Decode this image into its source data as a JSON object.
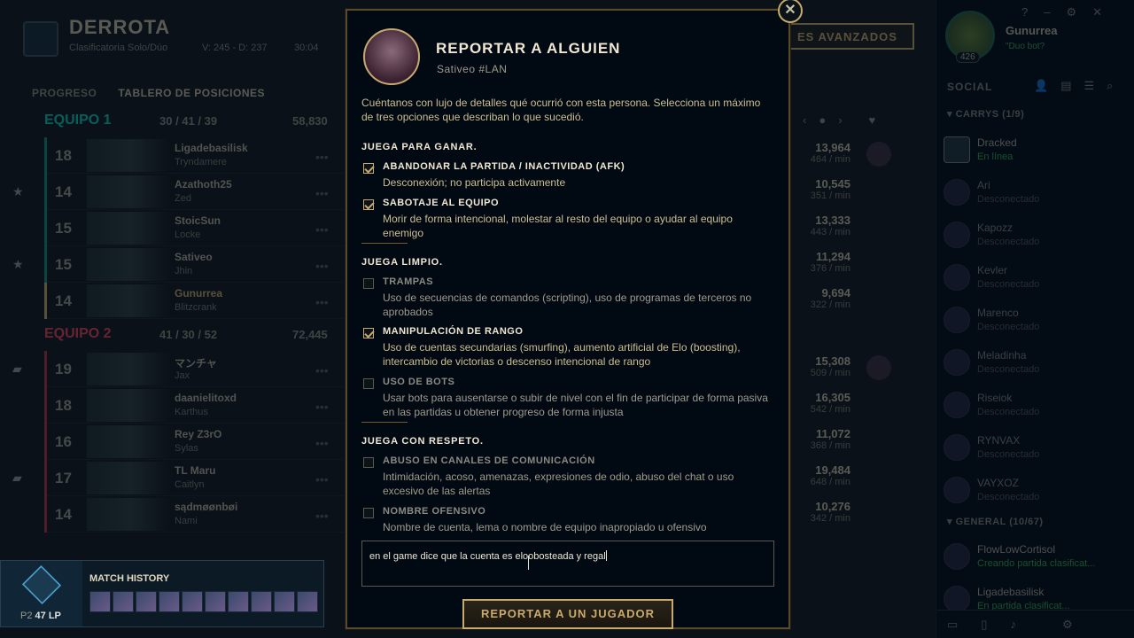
{
  "header": {
    "title": "DERROTA",
    "queue": "Clasificatoria Solo/Dúo",
    "record": "V: 245 - D: 237",
    "duration": "30:04"
  },
  "tabs": [
    "PROGRESO",
    "TABLERO DE POSICIONES"
  ],
  "advanced_button": "ES AVANZADOS",
  "team1": {
    "name": "EQUIPO 1",
    "kda": "30 / 41 / 39",
    "gold": "58,830",
    "color": "#0ac8b9",
    "players": [
      {
        "level": "18",
        "name": "Ligadebasilisk",
        "champion": "Tryndamere",
        "stat": "13,964",
        "sub": "464 / min"
      },
      {
        "level": "14",
        "name": "Azathoth25",
        "champion": "Zed",
        "stat": "10,545",
        "sub": "351 / min"
      },
      {
        "level": "15",
        "name": "StoicSun",
        "champion": "Locke",
        "stat": "13,333",
        "sub": "443 / min"
      },
      {
        "level": "15",
        "name": "Sativeo",
        "champion": "Jhin",
        "stat": "11,294",
        "sub": "376 / min"
      },
      {
        "level": "14",
        "name": "Gunurrea",
        "champion": "Blitzcrank",
        "stat": "9,694",
        "sub": "322 / min"
      }
    ]
  },
  "team2": {
    "name": "EQUIPO 2",
    "kda": "41 / 30 / 52",
    "gold": "72,445",
    "color": "#e84057",
    "players": [
      {
        "level": "19",
        "name": "マンチャ",
        "champion": "Jax",
        "stat": "15,308",
        "sub": "509 / min"
      },
      {
        "level": "18",
        "name": "daanielitoxd",
        "champion": "Karthus",
        "stat": "16,305",
        "sub": "542 / min"
      },
      {
        "level": "16",
        "name": "Rey Z3rO",
        "champion": "Sylas",
        "stat": "11,072",
        "sub": "368 / min"
      },
      {
        "level": "17",
        "name": "TL Maru",
        "champion": "Caitlyn",
        "stat": "19,484",
        "sub": "648 / min"
      },
      {
        "level": "14",
        "name": "sądmøønbøi",
        "champion": "Nami",
        "stat": "10,276",
        "sub": "342 / min"
      }
    ]
  },
  "match_history": {
    "title": "MATCH HISTORY",
    "rank": "P2",
    "lp": "47 LP"
  },
  "profile": {
    "name": "Gunurrea",
    "level": "426",
    "status": "\"Duo bot?"
  },
  "social": {
    "label": "SOCIAL",
    "group1": "CARRYS (1/9)",
    "group2": "GENERAL (10/67)",
    "friends": [
      {
        "name": "Dracked",
        "status": "En línea",
        "online": true
      },
      {
        "name": "Ari",
        "status": "Desconectado",
        "online": false
      },
      {
        "name": "Kapozz",
        "status": "Desconectado",
        "online": false
      },
      {
        "name": "Kevler",
        "status": "Desconectado",
        "online": false
      },
      {
        "name": "Marenco",
        "status": "Desconectado",
        "online": false
      },
      {
        "name": "Meladinha",
        "status": "Desconectado",
        "online": false
      },
      {
        "name": "Riseiok",
        "status": "Desconectado",
        "online": false
      },
      {
        "name": "RYNVAX",
        "status": "Desconectado",
        "online": false
      },
      {
        "name": "VAYXOZ",
        "status": "Desconectado",
        "online": false
      }
    ],
    "general": [
      {
        "name": "FlowLowCortisol",
        "status": "Creando partida clasificat..."
      },
      {
        "name": "Ligadebasilisk",
        "status": "En partida clasificat..."
      }
    ]
  },
  "dialog": {
    "title": "REPORTAR A ALGUIEN",
    "user": "Sativeo  #LAN",
    "description": "Cuéntanos con lujo de detalles qué ocurrió con esta persona. Selecciona un máximo de tres opciones que describan lo que sucedió.",
    "sections": [
      {
        "title": "JUEGA PARA GANAR.",
        "options": [
          {
            "title": "ABANDONAR LA PARTIDA / INACTIVIDAD (AFK)",
            "desc": "Desconexión; no participa activamente",
            "checked": true
          },
          {
            "title": "SABOTAJE AL EQUIPO",
            "desc": "Morir de forma intencional, molestar al resto del equipo o ayudar al equipo enemigo",
            "checked": true
          }
        ]
      },
      {
        "title": "JUEGA LIMPIO.",
        "options": [
          {
            "title": "TRAMPAS",
            "desc": "Uso de secuencias de comandos (scripting), uso de programas de terceros no aprobados",
            "checked": false
          },
          {
            "title": "MANIPULACIÓN DE RANGO",
            "desc": "Uso de cuentas secundarias (smurfing), aumento artificial de Elo (boosting), intercambio de victorias o descenso intencional de rango",
            "checked": true
          },
          {
            "title": "USO DE BOTS",
            "desc": "Usar bots para ausentarse o subir de nivel con el fin de participar de forma pasiva en las partidas u obtener progreso de forma injusta",
            "checked": false
          }
        ]
      },
      {
        "title": "JUEGA CON RESPETO.",
        "options": [
          {
            "title": "ABUSO EN CANALES DE COMUNICACIÓN",
            "desc": "Intimidación, acoso, amenazas, expresiones de odio, abuso del chat o uso excesivo de las alertas",
            "checked": false
          },
          {
            "title": "NOMBRE OFENSIVO",
            "desc": "Nombre de cuenta, lema o nombre de equipo inapropiado u ofensivo",
            "checked": false
          }
        ]
      }
    ],
    "comment": "en el game dice que la cuenta es eloobosteada y regal",
    "submit": "REPORTAR A UN JUGADOR"
  },
  "colors": {
    "gold": "#c8aa6e",
    "background": "#010a13",
    "online": "#3ab050"
  }
}
